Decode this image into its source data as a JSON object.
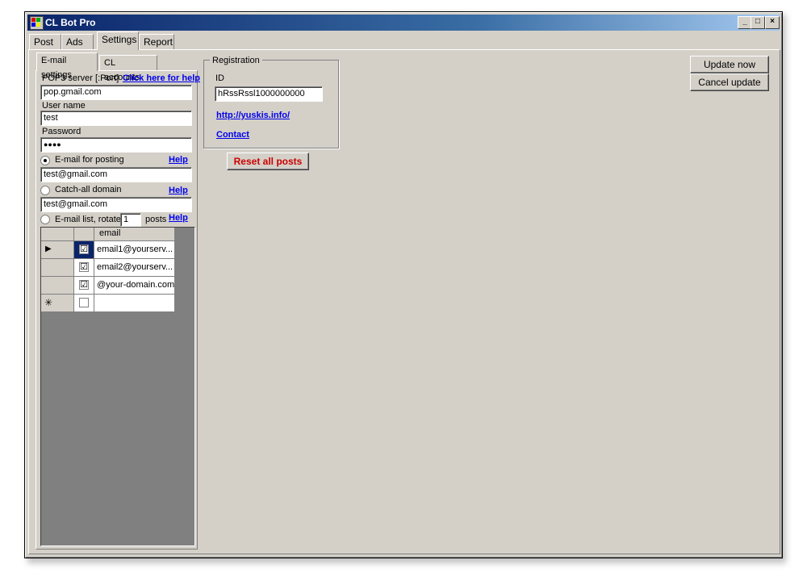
{
  "window": {
    "title": "CL Bot Pro",
    "minimize_glyph": "_",
    "maximize_glyph": "□",
    "close_glyph": "×"
  },
  "main_tabs": [
    {
      "label": "Post"
    },
    {
      "label": "Ads"
    },
    {
      "label": "Settings"
    },
    {
      "label": "Report"
    }
  ],
  "sub_tabs": [
    {
      "label": "E-mail settings"
    },
    {
      "label": "CL accounts"
    }
  ],
  "email_settings": {
    "pop3_label": "POP3 server [:Port]",
    "pop3_help": "Click here for help",
    "pop3_value": "pop.gmail.com",
    "username_label": "User name",
    "username_value": "test",
    "password_label": "Password",
    "password_value": "●●●●",
    "posting_label": "E-mail for posting",
    "posting_help": "Help",
    "posting_value": "test@gmail.com",
    "catchall_label": "Catch-all domain",
    "catchall_help": "Help",
    "catchall_value": "test@gmail.com",
    "list_label": "E-mail list, rotate",
    "rotate_value": "1",
    "posts_label": "posts",
    "list_help": "Help"
  },
  "email_grid": {
    "column_header": "email",
    "rows": [
      {
        "email": "email1@yourserv...",
        "checked": "☑",
        "indicator": "▶"
      },
      {
        "email": "email2@yourserv...",
        "checked": "☑",
        "indicator": ""
      },
      {
        "email": "@your-domain.com",
        "checked": "☑",
        "indicator": ""
      }
    ],
    "new_row_indicator": "✳"
  },
  "registration": {
    "group_label": "Registration",
    "id_label": "ID",
    "id_value": "hRssRssl1000000000",
    "website_link": "http://yuskis.info/",
    "contact_link": "Contact"
  },
  "buttons": {
    "reset_all": "Reset all posts",
    "update_now": "Update now",
    "cancel_update": "Cancel update"
  },
  "colors": {
    "title_bar": "#0a246a",
    "face": "#d4d0c8",
    "link": "#0000ee",
    "reset_text": "#cc0000"
  }
}
